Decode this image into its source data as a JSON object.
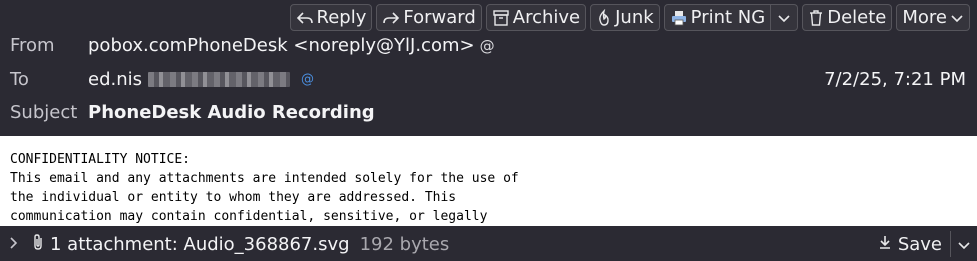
{
  "toolbar": {
    "reply": "Reply",
    "forward": "Forward",
    "archive": "Archive",
    "junk": "Junk",
    "print": "Print NG",
    "delete": "Delete",
    "more": "More"
  },
  "header": {
    "from_label": "From",
    "from_value": "pobox.comPhoneDesk <noreply@YlJ.com>",
    "to_label": "To",
    "to_value": "ed.nis",
    "date": "7/2/25, 7:21 PM",
    "subject_label": "Subject",
    "subject_value": "PhoneDesk Audio Recording"
  },
  "body": {
    "text": "CONFIDENTIALITY NOTICE:\nThis email and any attachments are intended solely for the use of\nthe individual or entity to whom they are addressed. This\ncommunication may contain confidential, sensitive, or legally"
  },
  "attachment": {
    "summary": "1 attachment: Audio_368867.svg",
    "size": "192 bytes",
    "save": "Save"
  },
  "colors": {
    "background": "#2b2a33",
    "accent_blue": "#4b8fe0"
  }
}
